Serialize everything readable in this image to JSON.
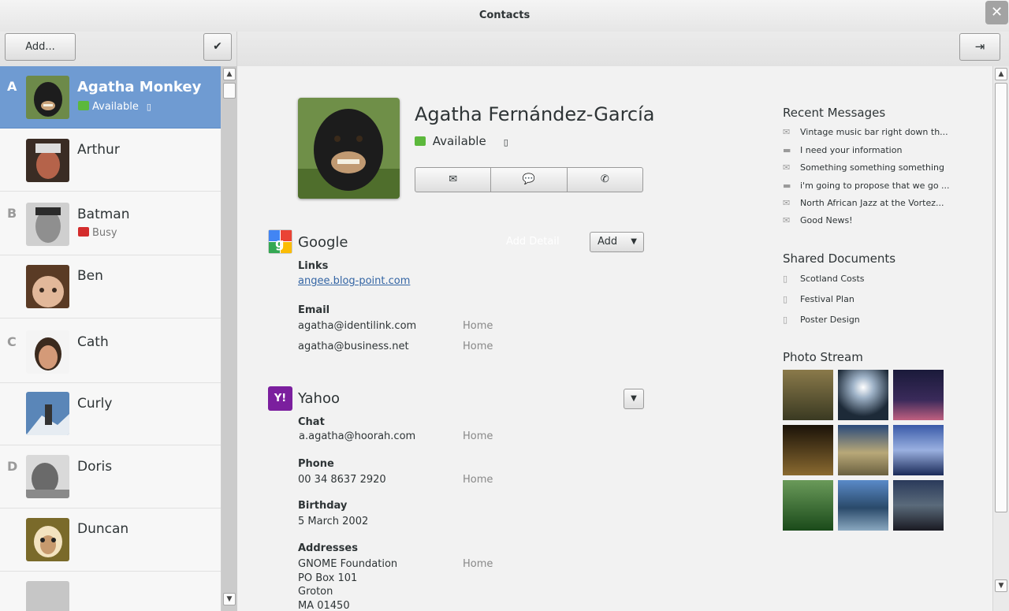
{
  "window": {
    "title": "Contacts",
    "close_glyph": "✕"
  },
  "toolbar": {
    "add_label": "Add...",
    "done_glyph": "✔",
    "link_glyph": "⇥"
  },
  "contacts": [
    {
      "letter": "A",
      "name": "Agatha Monkey",
      "status": "Available",
      "status_color": "green",
      "selected": true
    },
    {
      "letter": "",
      "name": "Arthur",
      "status": ""
    },
    {
      "letter": "B",
      "name": "Batman",
      "status": "Busy",
      "status_color": "red"
    },
    {
      "letter": "",
      "name": "Ben",
      "status": ""
    },
    {
      "letter": "C",
      "name": "Cath",
      "status": ""
    },
    {
      "letter": "",
      "name": "Curly",
      "status": ""
    },
    {
      "letter": "D",
      "name": "Doris",
      "status": ""
    },
    {
      "letter": "",
      "name": "Duncan",
      "status": ""
    }
  ],
  "detail": {
    "full_name": "Agatha Fernández-García",
    "status": "Available",
    "actions": [
      "✉",
      "💬",
      "✆"
    ],
    "google": {
      "name": "Google",
      "add_detail": "Add Detail",
      "add_label": "Add",
      "links_label": "Links",
      "link": "angee.blog-point.com",
      "email_label": "Email",
      "emails": [
        {
          "value": "agatha@identilink.com",
          "type": "Home"
        },
        {
          "value": "agatha@business.net",
          "type": "Home"
        }
      ]
    },
    "yahoo": {
      "name": "Yahoo",
      "icon_text": "Y!",
      "chat_label": "Chat",
      "chat": {
        "value": "a.agatha@hoorah.com",
        "type": "Home"
      },
      "phone_label": "Phone",
      "phone": {
        "value": "00 34 8637 2920",
        "type": "Home"
      },
      "birthday_label": "Birthday",
      "birthday": "5 March 2002",
      "addresses_label": "Addresses",
      "address_lines": [
        "GNOME Foundation",
        "PO Box 101",
        "Groton",
        "MA 01450"
      ],
      "address_type": "Home"
    }
  },
  "sidebar": {
    "recent_title": "Recent Messages",
    "messages": [
      {
        "kind": "mail",
        "text": "Vintage music bar right down th..."
      },
      {
        "kind": "chat",
        "text": "I need your information"
      },
      {
        "kind": "mail",
        "text": "Something something something"
      },
      {
        "kind": "chat",
        "text": "i'm going to propose that we go ..."
      },
      {
        "kind": "mail",
        "text": "North African Jazz at the Vortez..."
      },
      {
        "kind": "mail",
        "text": "Good News!"
      }
    ],
    "docs_title": "Shared Documents",
    "docs": [
      "Scotland Costs",
      "Festival Plan",
      "Poster Design"
    ],
    "photos_title": "Photo Stream"
  }
}
